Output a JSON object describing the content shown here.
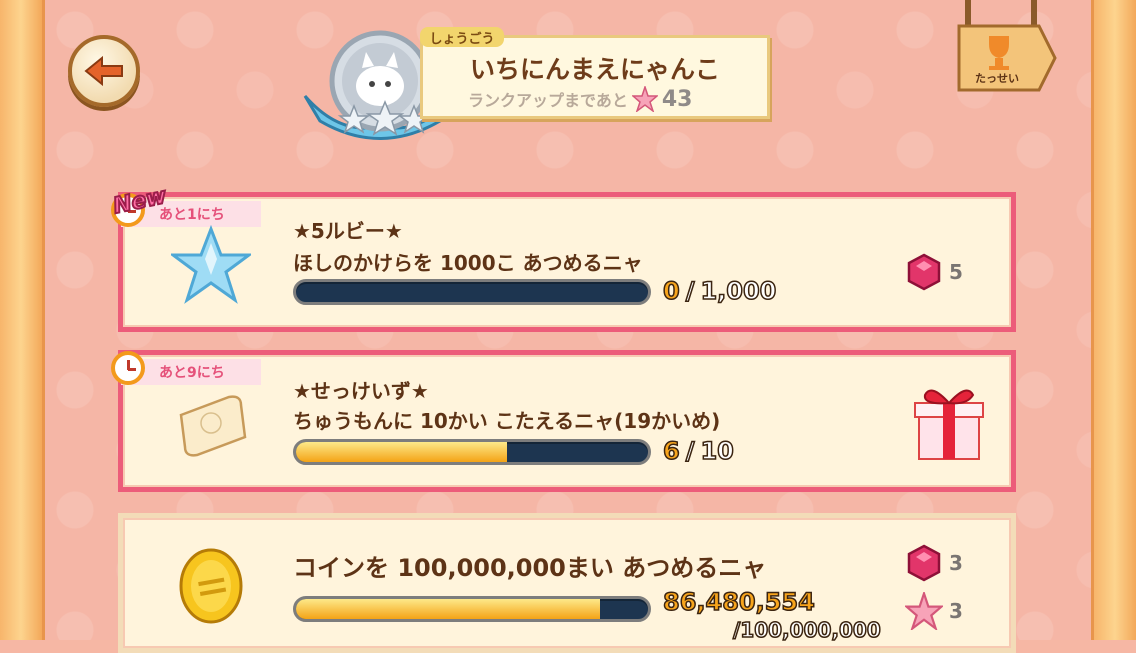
{
  "header": {
    "title_tag": "しょうごう",
    "title_name": "いちにんまえにゃんこ",
    "rank_up_label": "ランクアップまであと",
    "rank_up_count": "43",
    "achievements_label": "たっせい"
  },
  "missions": [
    {
      "tag": "あと1にち",
      "new_label": "New",
      "title": "★5ルビー★",
      "desc": "ほしのかけらを 1000こ あつめるニャ",
      "current": "0",
      "separator": "/",
      "total": "1,000",
      "progress": 0,
      "reward_count": "5"
    },
    {
      "tag": "あと9にち",
      "title": "★せっけいず★",
      "desc": "ちゅうもんに 10かい こたえるニャ(19かいめ)",
      "current": "6",
      "separator": "/",
      "total": "10",
      "progress": 0.6
    },
    {
      "desc": "コインを 100,000,000まい あつめるニャ",
      "current": "86,480,554",
      "total": "/100,000,000",
      "progress": 0.8648,
      "reward_ruby_count": "3",
      "reward_star_count": "3"
    }
  ],
  "colors": {
    "card_border_active": "#ec5c7a",
    "bar_fill": "#f4a316",
    "bar_empty": "#1d3550"
  }
}
